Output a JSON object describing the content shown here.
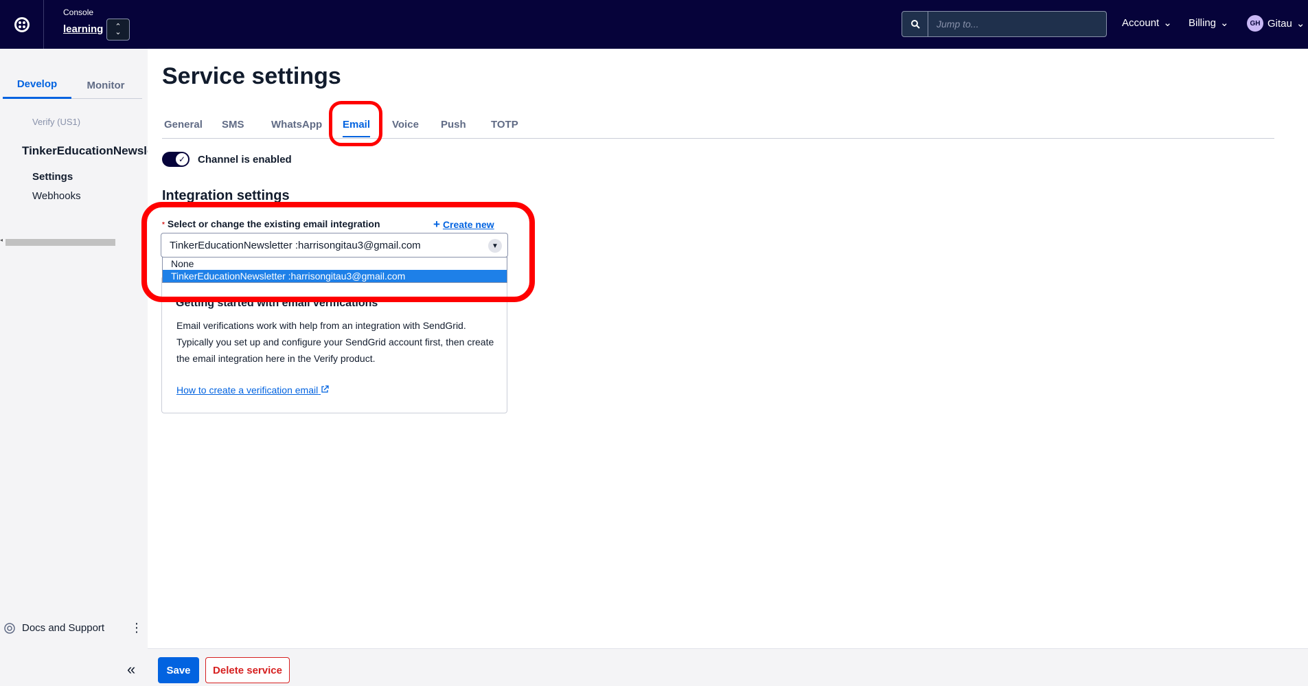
{
  "topbar": {
    "console_label": "Console",
    "account_name": "learning",
    "search_placeholder": "Jump to...",
    "account_menu": "Account",
    "billing_menu": "Billing",
    "user_initials": "GH",
    "user_name": "Gitau"
  },
  "sidebar": {
    "tabs": [
      {
        "label": "Develop",
        "active": true
      },
      {
        "label": "Monitor",
        "active": false
      }
    ],
    "product_label": "Verify (US1)",
    "service_name": "TinkerEducationNewsletter",
    "items": [
      {
        "label": "Settings",
        "active": true
      },
      {
        "label": "Webhooks",
        "active": false
      }
    ],
    "docs_label": "Docs and Support"
  },
  "main": {
    "title": "Service settings",
    "tabs": [
      {
        "label": "General"
      },
      {
        "label": "SMS"
      },
      {
        "label": "WhatsApp"
      },
      {
        "label": "Email",
        "active": true
      },
      {
        "label": "Voice"
      },
      {
        "label": "Push"
      },
      {
        "label": "TOTP"
      }
    ],
    "channel_toggle_label": "Channel is enabled",
    "channel_enabled": true,
    "section_title": "Integration settings",
    "field_label": "Select or change the existing email integration",
    "create_new_label": "Create new",
    "select_value": "TinkerEducationNewsletter :harrisongitau3@gmail.com",
    "options": [
      {
        "label": "None"
      },
      {
        "label": "TinkerEducationNewsletter :harrisongitau3@gmail.com",
        "selected": true
      }
    ],
    "info_card": {
      "title": "Getting started with email verifications",
      "body": "Email verifications work with help from an integration with SendGrid. Typically you set up and configure your SendGrid account first, then create the email integration here in the Verify product.",
      "link": "How to create a verification email"
    }
  },
  "footer": {
    "save_label": "Save",
    "delete_label": "Delete service"
  },
  "colors": {
    "topbar_bg": "#06033a",
    "accent": "#0263e0",
    "danger": "#d61f1f",
    "annotation_red": "#ff0000"
  }
}
